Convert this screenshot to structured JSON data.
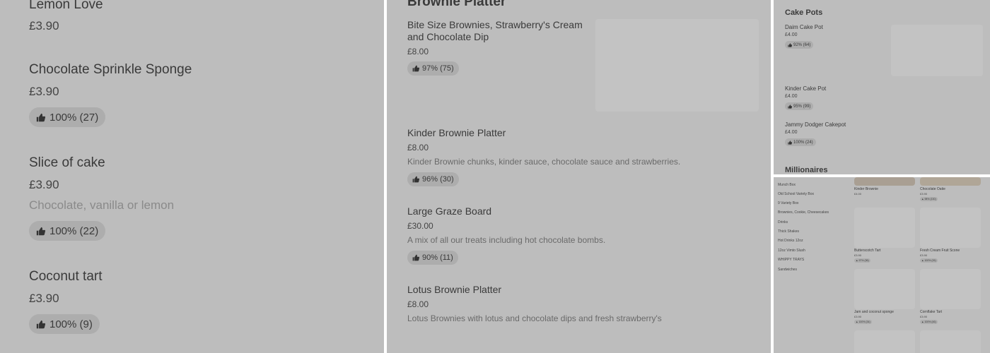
{
  "panel1": {
    "items": [
      {
        "name": "Lemon Love",
        "price": "£3.90"
      },
      {
        "name": "Chocolate Sprinkle Sponge",
        "price": "£3.90",
        "rating": "100% (27)"
      },
      {
        "name": "Slice of cake",
        "price": "£3.90",
        "description": "Chocolate, vanilla or lemon",
        "rating": "100% (22)"
      },
      {
        "name": "Coconut tart",
        "price": "£3.90",
        "rating": "100% (9)"
      }
    ]
  },
  "panel2": {
    "section_title": "Brownie Platter",
    "items": [
      {
        "name_line1": "Bite Size Brownies, Strawberry's Cream",
        "name_line2": "and Chocolate Dip",
        "price": "£8.00",
        "rating": "97% (75)"
      },
      {
        "name": "Kinder Brownie Platter",
        "price": "£8.00",
        "description": "Kinder Brownie chunks, kinder sauce, chocolate sauce and strawberries.",
        "rating": "96% (30)"
      },
      {
        "name": "Large Graze Board",
        "price": "£30.00",
        "description": "A mix of all our treats including hot chocolate bombs.",
        "rating": "90% (11)"
      },
      {
        "name": "Lotus Brownie Platter",
        "price": "£8.00",
        "description": "Lotus Brownies with lotus and chocolate dips and fresh strawberry's"
      }
    ]
  },
  "panel3": {
    "section_title": "Cake Pots",
    "items": [
      {
        "name": "Daim Cake Pot",
        "price": "£4.00",
        "rating": "92% (64)"
      },
      {
        "name": "Kinder Cake Pot",
        "price": "£4.00",
        "rating": "95% (99)"
      },
      {
        "name": "Jammy Dodger Cakepot",
        "price": "£4.00",
        "rating": "100% (24)"
      }
    ],
    "next_section_title": "Millionaires"
  },
  "panel4": {
    "nav_items": [
      "Munch Box",
      "Old School Variety Box",
      "9 Variety Box",
      "Brownies, Cookie, Cheesecakes",
      "Drinks",
      "Thick Shakes",
      "Hot Drinks 12oz",
      "12oz Vimto Slush",
      "WHIPPY TRAYS",
      "Sandwiches"
    ],
    "cards": [
      {
        "name": "Kinder Brownie",
        "price": "£4.00"
      },
      {
        "name": "Chocolate Oatie",
        "price": "£3.90",
        "rating": "98% (130)"
      },
      {
        "name": "Butterscotch Tart",
        "price": "£3.90",
        "rating": "97% (36)"
      },
      {
        "name": "Fresh Cream Fruit Scone",
        "price": "£3.90",
        "rating": "100% (26)"
      },
      {
        "name": "Jam and coconut sponge",
        "price": "£3.90",
        "rating": "100% (34)"
      },
      {
        "name": "Cornflake Tart",
        "price": "£3.90",
        "rating": "100% (46)"
      }
    ]
  },
  "colors": {
    "overlay": "#bdbdbd",
    "badge": "#adadad",
    "divider": "#ffffff"
  }
}
